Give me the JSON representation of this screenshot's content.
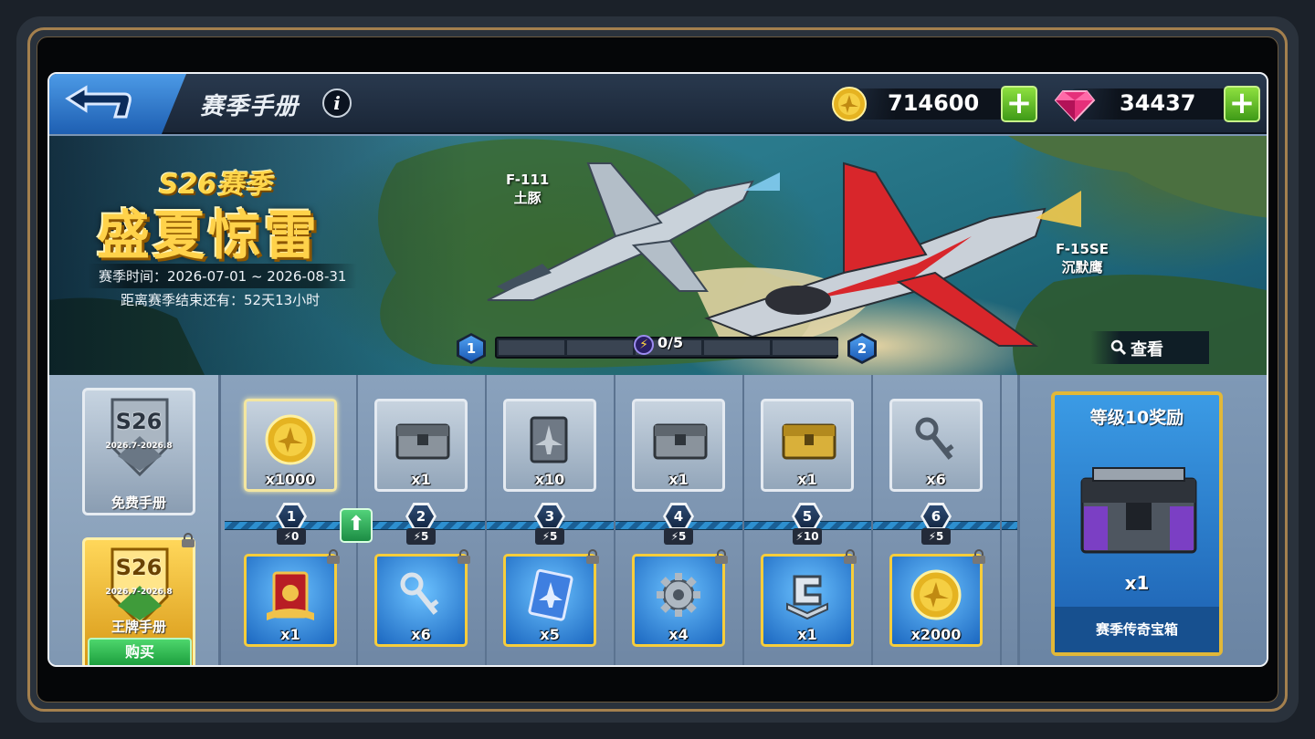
{
  "header": {
    "title": "赛季手册",
    "info_icon": "i",
    "gold": "714600",
    "gems": "34437",
    "plus": "+"
  },
  "banner": {
    "season_name": "S26赛季",
    "season_theme": "盛夏惊雷",
    "season_time": "赛季时间：2026-07-01 ~ 2026-08-31",
    "time_left": "距离赛季结束还有：52天13小时",
    "jet_left_model": "F-111",
    "jet_left_name": "土豚",
    "jet_right_model": "F-15SE",
    "jet_right_name": "沉默鹰",
    "level_from": "1",
    "level_to": "2",
    "progress_text": "0/5",
    "progress_value": 0,
    "progress_max": 5,
    "view_label": "查看"
  },
  "manuals": {
    "free_badge": "S26",
    "free_badge_sub": "2026.7-2026.8",
    "free_label": "免费手册",
    "ace_badge": "S26",
    "ace_badge_sub": "2026.7-2026.8",
    "ace_label": "王牌手册",
    "buy_label": "购买"
  },
  "levels": [
    {
      "level": "1",
      "cost": "0",
      "free_qty": "x1000",
      "free_icon": "gold-coin-icon",
      "paid_qty": "x1",
      "paid_icon": "red-card-icon"
    },
    {
      "level": "2",
      "cost": "5",
      "free_qty": "x1",
      "free_icon": "steel-crate-icon",
      "paid_qty": "x6",
      "paid_icon": "key-icon"
    },
    {
      "level": "3",
      "cost": "5",
      "free_qty": "x10",
      "free_icon": "jet-card-icon",
      "paid_qty": "x5",
      "paid_icon": "blue-jet-card-icon"
    },
    {
      "level": "4",
      "cost": "5",
      "free_qty": "x1",
      "free_icon": "steel-crate-icon",
      "paid_qty": "x4",
      "paid_icon": "gear-icon"
    },
    {
      "level": "5",
      "cost": "10",
      "free_qty": "x1",
      "free_icon": "gold-crate-icon",
      "paid_qty": "x1",
      "paid_icon": "c-manual-icon"
    },
    {
      "level": "6",
      "cost": "5",
      "free_qty": "x6",
      "free_icon": "key-icon",
      "paid_qty": "x2000",
      "paid_icon": "gold-coin-icon"
    }
  ],
  "level_up_arrow": "⬆",
  "reward": {
    "title": "等级10奖励",
    "qty": "x1",
    "name": "赛季传奇宝箱"
  },
  "colors": {
    "gold": "#ffd24a",
    "paid_border": "#f7cd3b",
    "buy_green": "#1a9b3b",
    "rail_blue": "#2d8fcf"
  }
}
